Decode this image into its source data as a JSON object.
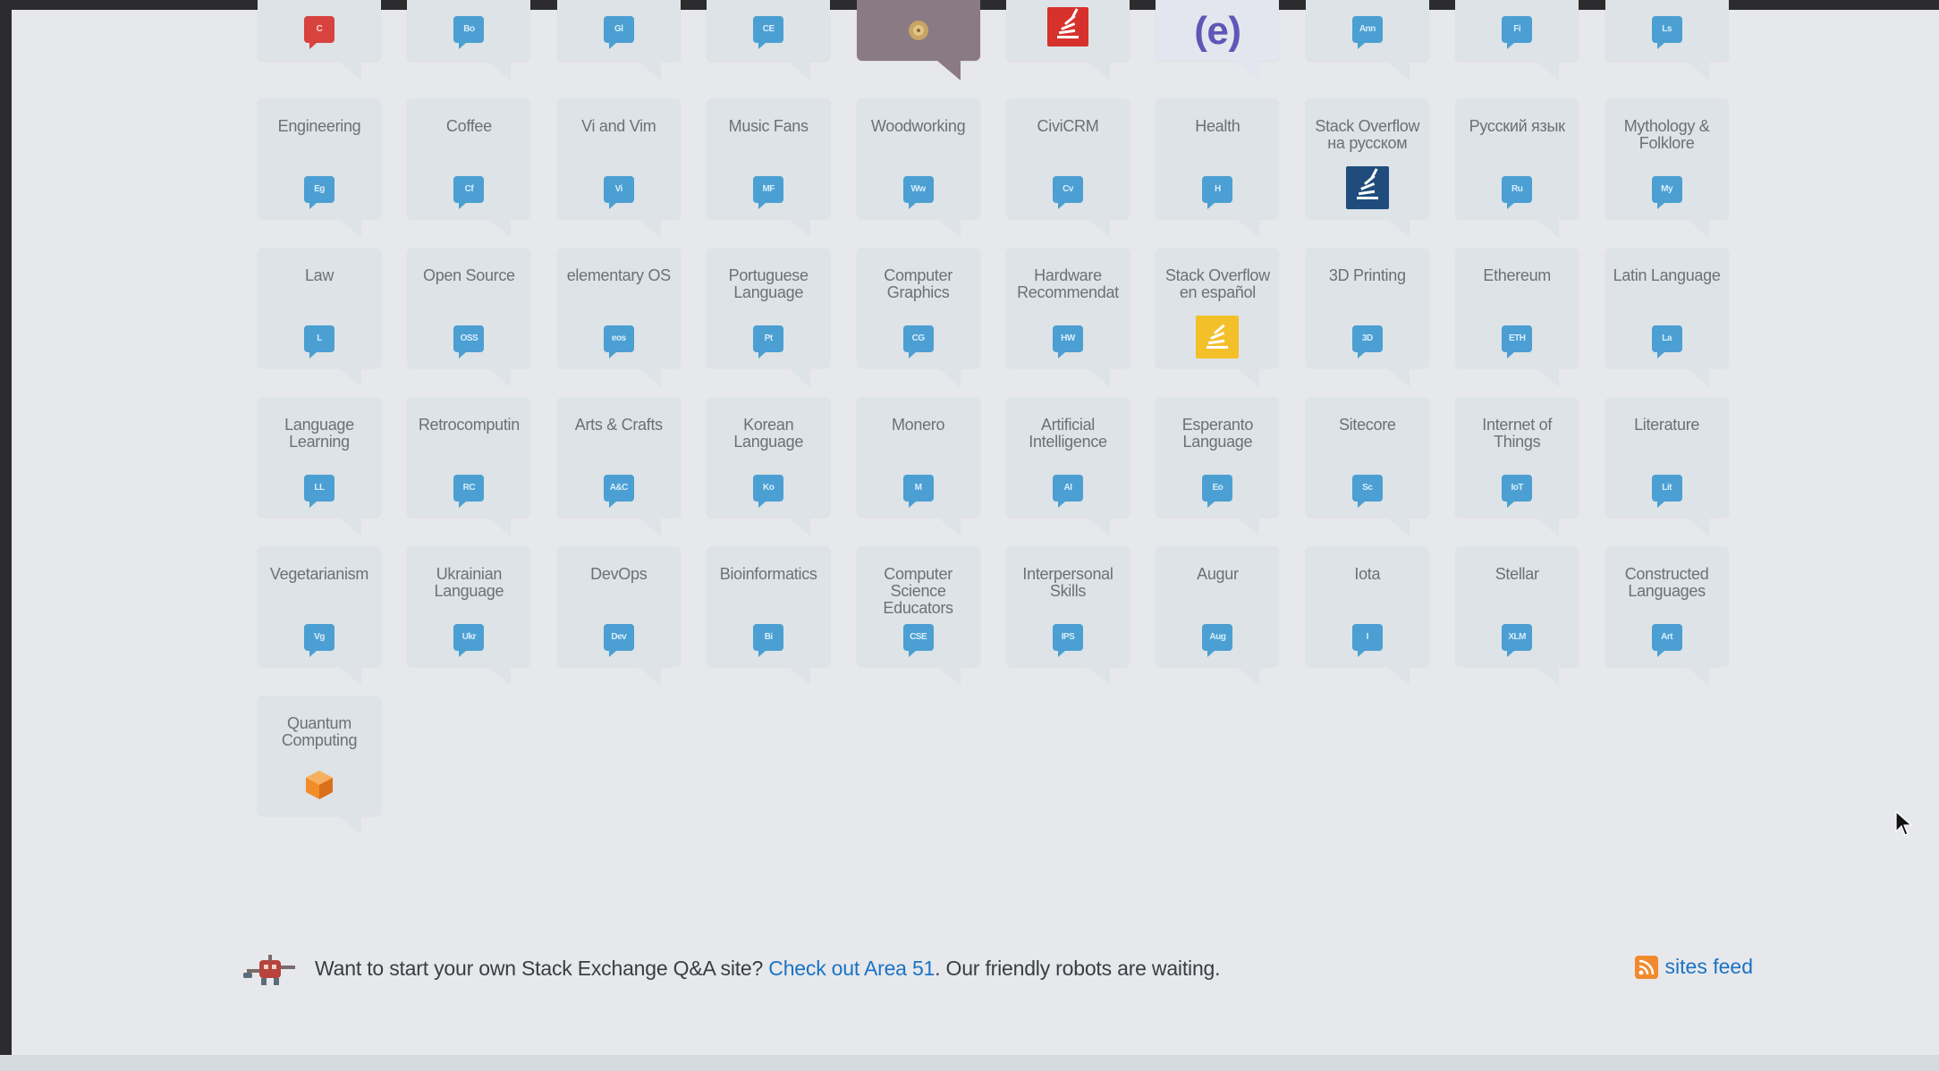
{
  "top_row": [
    {
      "icon": "C",
      "icon_style": "red",
      "highlight": false
    },
    {
      "icon": "Bo",
      "icon_style": "blue",
      "highlight": false
    },
    {
      "icon": "Gl",
      "icon_style": "blue",
      "highlight": false
    },
    {
      "icon": "CE",
      "icon_style": "blue",
      "highlight": false
    },
    {
      "icon": "",
      "icon_style": "wood",
      "highlight": true
    },
    {
      "icon": "",
      "icon_style": "so",
      "highlight": false
    },
    {
      "icon": "(e)",
      "icon_style": "e",
      "highlight": false,
      "light": true
    },
    {
      "icon": "Ann",
      "icon_style": "blue",
      "highlight": false
    },
    {
      "icon": "Fi",
      "icon_style": "blue",
      "highlight": false
    },
    {
      "icon": "Ls",
      "icon_style": "blue",
      "highlight": false
    }
  ],
  "rows": [
    [
      {
        "name": "Engineering",
        "icon": "Eg"
      },
      {
        "name": "Coffee",
        "icon": "Cf"
      },
      {
        "name": "Vi and Vim",
        "icon": "Vi"
      },
      {
        "name": "Music Fans",
        "icon": "MF"
      },
      {
        "name": "Woodworking",
        "icon": "Ww"
      },
      {
        "name": "CiviCRM",
        "icon": "Cv"
      },
      {
        "name": "Health",
        "icon": "H"
      },
      {
        "name": "Stack Overflow на русском",
        "icon": "",
        "icon_style": "sodark"
      },
      {
        "name": "Русский язык",
        "icon": "Ru"
      },
      {
        "name": "Mythology & Folklore",
        "icon": "My"
      }
    ],
    [
      {
        "name": "Law",
        "icon": "L"
      },
      {
        "name": "Open Source",
        "icon": "OSS"
      },
      {
        "name": "elementary OS",
        "icon": "eos"
      },
      {
        "name": "Portuguese Language",
        "icon": "Pt"
      },
      {
        "name": "Computer Graphics",
        "icon": "CG"
      },
      {
        "name": "Hardware Recommendat",
        "icon": "HW"
      },
      {
        "name": "Stack Overflow en español",
        "icon": "",
        "icon_style": "soes"
      },
      {
        "name": "3D Printing",
        "icon": "3D"
      },
      {
        "name": "Ethereum",
        "icon": "ETH"
      },
      {
        "name": "Latin Language",
        "icon": "La"
      }
    ],
    [
      {
        "name": "Language Learning",
        "icon": "LL"
      },
      {
        "name": "Retrocomputin",
        "icon": "RC"
      },
      {
        "name": "Arts & Crafts",
        "icon": "A&C"
      },
      {
        "name": "Korean Language",
        "icon": "Ko"
      },
      {
        "name": "Monero",
        "icon": "M"
      },
      {
        "name": "Artificial Intelligence",
        "icon": "AI"
      },
      {
        "name": "Esperanto Language",
        "icon": "Eo"
      },
      {
        "name": "Sitecore",
        "icon": "Sc"
      },
      {
        "name": "Internet of Things",
        "icon": "IoT"
      },
      {
        "name": "Literature",
        "icon": "Lit"
      }
    ],
    [
      {
        "name": "Vegetarianism",
        "icon": "Vg"
      },
      {
        "name": "Ukrainian Language",
        "icon": "Ukr"
      },
      {
        "name": "DevOps",
        "icon": "Dev"
      },
      {
        "name": "Bioinformatics",
        "icon": "Bi"
      },
      {
        "name": "Computer Science Educators",
        "icon": "CSE"
      },
      {
        "name": "Interpersonal Skills",
        "icon": "IPS"
      },
      {
        "name": "Augur",
        "icon": "Aug"
      },
      {
        "name": "Iota",
        "icon": "I"
      },
      {
        "name": "Stellar",
        "icon": "XLM"
      },
      {
        "name": "Constructed Languages",
        "icon": "Art"
      }
    ],
    [
      {
        "name": "Quantum Computing",
        "icon": "",
        "icon_style": "qc"
      }
    ]
  ],
  "footer": {
    "text_before": "Want to start your own Stack Exchange Q&A site? ",
    "link_text": "Check out Area 51",
    "text_after": ". Our friendly robots are waiting.",
    "feed_label": "sites feed"
  },
  "colors": {
    "tile": "#dde3e6",
    "tile_highlight": "#8a7a83",
    "icon_blue": "#4b9fd3",
    "link": "#1a73c4",
    "rss": "#f08a2c"
  }
}
